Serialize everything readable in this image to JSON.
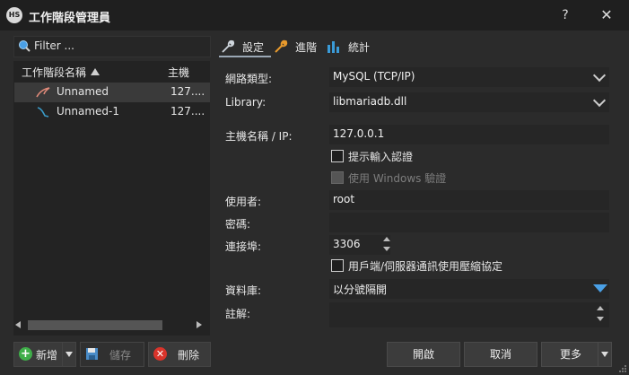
{
  "window": {
    "title": "工作階段管理員",
    "app_icon_text": "HS",
    "help_label": "?",
    "close_label": "✕"
  },
  "left": {
    "filter_placeholder": "Filter ...",
    "columns": {
      "name": "工作階段名稱",
      "host": "主機"
    },
    "sessions": [
      {
        "name": "Unnamed",
        "host": "127....",
        "icon": "dolphin-icon"
      },
      {
        "name": "Unnamed-1",
        "host": "127....",
        "icon": "dolphin-icon"
      }
    ],
    "buttons": {
      "new": "新增",
      "save": "儲存",
      "delete": "刪除"
    }
  },
  "tabs": [
    {
      "label": "設定",
      "icon": "wrench-icon"
    },
    {
      "label": "進階",
      "icon": "wrench-icon"
    },
    {
      "label": "統計",
      "icon": "bar-chart-icon"
    }
  ],
  "form": {
    "network_type": {
      "label": "網路類型:",
      "value": "MySQL (TCP/IP)"
    },
    "library": {
      "label": "Library:",
      "value": "libmariadb.dll"
    },
    "host": {
      "label": "主機名稱 / IP:",
      "value": "127.0.0.1"
    },
    "prompt_login": {
      "label": "提示輸入認證",
      "checked": false
    },
    "windows_auth": {
      "label": "使用 Windows 驗證",
      "checked": false,
      "disabled": true
    },
    "user": {
      "label": "使用者:",
      "value": "root"
    },
    "password": {
      "label": "密碼:",
      "value": ""
    },
    "port": {
      "label": "連接埠:",
      "value": "3306"
    },
    "compression": {
      "label": "用戶端/伺服器通訊使用壓縮協定",
      "checked": false
    },
    "databases": {
      "label": "資料庫:",
      "value": "以分號隔開"
    },
    "comment": {
      "label": "註解:",
      "value": ""
    }
  },
  "actions": {
    "open": "開啟",
    "cancel": "取消",
    "more": "更多"
  },
  "colors": {
    "background": "#2b2b2b",
    "titlebar": "#1f1f1f",
    "accent": "#4aa0e6",
    "new_icon": "#3fae49",
    "delete_icon": "#d9342b",
    "wrench": "#e89a2c"
  }
}
